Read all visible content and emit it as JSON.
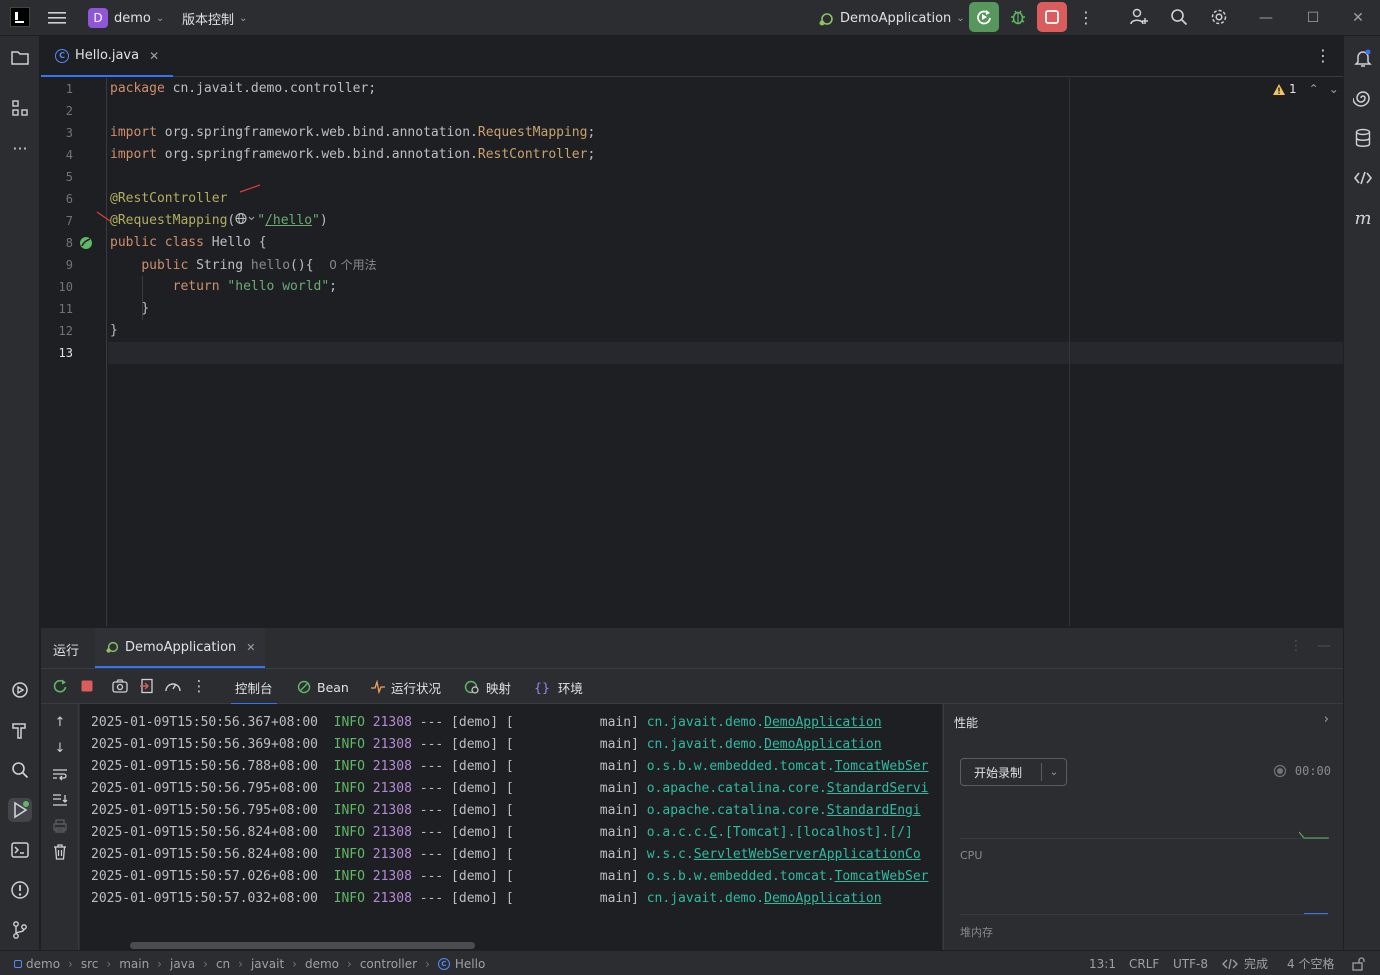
{
  "titlebar": {
    "project_badge": "D",
    "project_name": "demo",
    "vcs_label": "版本控制",
    "run_config": "DemoApplication"
  },
  "editor": {
    "tab_label": "Hello.java",
    "warning_count": "1",
    "lines": [
      "1",
      "2",
      "3",
      "4",
      "5",
      "6",
      "7",
      "8",
      "9",
      "10",
      "11",
      "12",
      "13"
    ],
    "code": {
      "l1_kw": "package",
      "l1_rest": " cn.javait.demo.controller;",
      "l3_kw": "import",
      "l3_pkg": " org.springframework.web.bind.annotation.",
      "l3_cls": "RequestMapping",
      "l3_end": ";",
      "l4_kw": "import",
      "l4_pkg": " org.springframework.web.bind.annotation.",
      "l4_cls": "RestController",
      "l4_end": ";",
      "l6_ann": "@RestController",
      "l7_ann": "@RequestMapping",
      "l7_open": "(",
      "l7_q1": "\"",
      "l7_url": "/hello",
      "l7_q2": "\"",
      "l7_close": ")",
      "l8_kw": "public class",
      "l8_rest": " Hello {",
      "l9_kw": "public",
      "l9_type": " String ",
      "l9_fn": "hello",
      "l9_rest": "(){",
      "l9_hint": "0 个用法",
      "l10_kw": "return",
      "l10_str": "\"hello world\"",
      "l10_end": ";",
      "l11": "}",
      "l12": "}"
    }
  },
  "run": {
    "title": "运行",
    "config_tab": "DemoApplication",
    "tabs": [
      "控制台",
      "Bean",
      "运行状况",
      "映射",
      "环境"
    ],
    "log": [
      {
        "ts": "2025-01-09T15:50:56.367+08:00",
        "lvl": "INFO",
        "pid": "21308",
        "mid": " --- [demo] [           main] ",
        "pkg": "cn.javait.demo.",
        "cls": "DemoApplication"
      },
      {
        "ts": "2025-01-09T15:50:56.369+08:00",
        "lvl": "INFO",
        "pid": "21308",
        "mid": " --- [demo] [           main] ",
        "pkg": "cn.javait.demo.",
        "cls": "DemoApplication"
      },
      {
        "ts": "2025-01-09T15:50:56.788+08:00",
        "lvl": "INFO",
        "pid": "21308",
        "mid": " --- [demo] [           main] ",
        "pkg": "o.s.b.w.embedded.tomcat.",
        "cls": "TomcatWebSer"
      },
      {
        "ts": "2025-01-09T15:50:56.795+08:00",
        "lvl": "INFO",
        "pid": "21308",
        "mid": " --- [demo] [           main] ",
        "pkg": "o.apache.catalina.core.",
        "cls": "StandardServi"
      },
      {
        "ts": "2025-01-09T15:50:56.795+08:00",
        "lvl": "INFO",
        "pid": "21308",
        "mid": " --- [demo] [           main] ",
        "pkg": "o.apache.catalina.core.",
        "cls": "StandardEngi"
      },
      {
        "ts": "2025-01-09T15:50:56.824+08:00",
        "lvl": "INFO",
        "pid": "21308",
        "mid": " --- [demo] [           main] ",
        "pkg": "o.a.c.c.",
        "cls": "C",
        "tail": ".[Tomcat].[localhost].[/]"
      },
      {
        "ts": "2025-01-09T15:50:56.824+08:00",
        "lvl": "INFO",
        "pid": "21308",
        "mid": " --- [demo] [           main] ",
        "pkg": "w.s.c.",
        "cls": "ServletWebServerApplicationCo"
      },
      {
        "ts": "2025-01-09T15:50:57.026+08:00",
        "lvl": "INFO",
        "pid": "21308",
        "mid": " --- [demo] [           main] ",
        "pkg": "o.s.b.w.embedded.tomcat.",
        "cls": "TomcatWebSer"
      },
      {
        "ts": "2025-01-09T15:50:57.032+08:00",
        "lvl": "INFO",
        "pid": "21308",
        "mid": " --- [demo] [           main] ",
        "pkg": "cn.javait.demo.",
        "cls": "DemoApplication"
      }
    ],
    "perf": {
      "title": "性能",
      "record_label": "开始录制",
      "timer": "00:00",
      "cpu_label": "CPU",
      "heap_label": "堆内存"
    }
  },
  "statusbar": {
    "breadcrumb": [
      "demo",
      "src",
      "main",
      "java",
      "cn",
      "javait",
      "demo",
      "controller",
      "Hello"
    ],
    "position": "13:1",
    "line_sep": "CRLF",
    "encoding": "UTF-8",
    "status": "完成",
    "indent": "4 个空格"
  }
}
